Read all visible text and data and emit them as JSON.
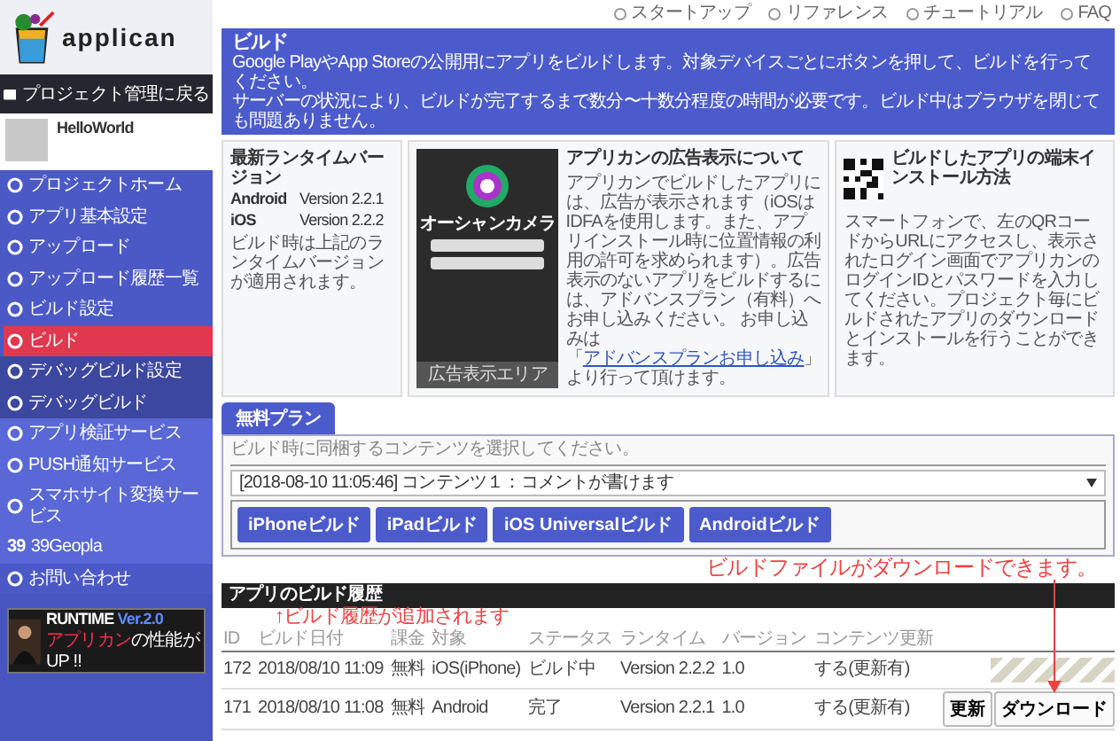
{
  "topbar": {
    "links": [
      {
        "label": "スタートアップ"
      },
      {
        "label": "リファレンス"
      },
      {
        "label": "チュートリアル"
      },
      {
        "label": "FAQ"
      }
    ]
  },
  "sidebar": {
    "logo": "applican",
    "back": "プロジェクト管理に戻る",
    "project": "HelloWorld",
    "items": [
      {
        "label": "プロジェクトホーム",
        "kind": "main",
        "selected": false
      },
      {
        "label": "アプリ基本設定",
        "kind": "main",
        "selected": false
      },
      {
        "label": "アップロード",
        "kind": "main",
        "selected": false
      },
      {
        "label": "アップロード履歴一覧",
        "kind": "main",
        "selected": false
      },
      {
        "label": "ビルド設定",
        "kind": "main",
        "selected": false
      },
      {
        "label": "ビルド",
        "kind": "main",
        "selected": true
      },
      {
        "label": "デバッグビルド設定",
        "kind": "debug",
        "selected": false
      },
      {
        "label": "デバッグビルド",
        "kind": "debug",
        "selected": false
      },
      {
        "label": "アプリ検証サービス",
        "kind": "service",
        "selected": false
      },
      {
        "label": "PUSH通知サービス",
        "kind": "service",
        "selected": false
      },
      {
        "label": "スマホサイト変換サービス",
        "kind": "service",
        "selected": false
      },
      {
        "label": "39Geopla",
        "kind": "service",
        "badge": "39",
        "selected": false
      },
      {
        "label": "お問い合わせ",
        "kind": "contact",
        "selected": false
      }
    ],
    "banner": {
      "title": "RUNTIME",
      "version": "Ver.2.0",
      "highlight": "アプリカン",
      "tagline": "の性能が UP !!"
    }
  },
  "header": {
    "title": "ビルド",
    "lines": [
      "Google PlayやApp Storeの公開用にアプリをビルドします。対象デバイスごとにボタンを押して、ビルドを行ってください。",
      "サーバーの状況により、ビルドが完了するまで数分〜十数分程度の時間が必要です。ビルド中はブラウザを閉じても問題ありません。"
    ]
  },
  "runtime_card": {
    "title": "最新ランタイムバージョン",
    "rows": [
      {
        "platform": "Android",
        "version": "Version 2.2.1"
      },
      {
        "platform": "iOS",
        "version": "Version 2.2.2"
      }
    ],
    "note": "ビルド時は上記のランタイムバージョンが適用されます。"
  },
  "ads_card": {
    "title": "アプリカンの広告表示について",
    "phone": {
      "app_title": "オーシャンカメラ",
      "ad_area": "広告表示エリア"
    },
    "text": "アプリカンでビルドしたアプリには、広告が表示されます（iOSはIDFAを使用します。また、アプリインストール時に位置情報の利用の許可を求められます）。広告表示のないアプリをビルドするには、アドバンスプラン（有料）へお申し込みください。 お申し込みは「",
    "link": "アドバンスプランお申し込み",
    "text_after": "」より行って頂けます。"
  },
  "install_card": {
    "title": "ビルドしたアプリの端末インストール方法",
    "text": "スマートフォンで、左のQRコードからURLにアクセスし、表示されたログイン画面でアプリカンのログインIDとパスワードを入力してください。プロジェクト毎にビルドされたアプリのダウンロードとインストールを行うことができます。"
  },
  "plan": {
    "tabs": [
      {
        "label": "無料プラン",
        "selected": true
      }
    ],
    "hint": "ビルド時に同梱するコンテンツを選択してください。",
    "content": "[2018-08-10 11:05:46] コンテンツ１：コメントが書けます",
    "buttons": [
      "iPhoneビルド",
      "iPadビルド",
      "iOS Universalビルド",
      "Androidビルド"
    ]
  },
  "annotations": {
    "download": "ビルドファイルがダウンロードできます。",
    "history": "↑ビルド履歴が追加されます"
  },
  "history": {
    "title": "アプリのビルド履歴",
    "columns": [
      "ID",
      "ビルド日付",
      "課金",
      "対象",
      "ステータス",
      "ランタイム",
      "バージョン",
      "コンテンツ更新"
    ],
    "rows": [
      {
        "kind": "building",
        "cells": [
          "172",
          "2018/08/10 11:09",
          "無料",
          "iOS(iPhone)",
          "ビルド中",
          "Version 2.2.2",
          "1.0",
          "する(更新有)"
        ]
      },
      {
        "kind": "done",
        "cells": [
          "171",
          "2018/08/10 11:08",
          "無料",
          "Android",
          "完了",
          "Version 2.2.1",
          "1.0",
          "する(更新有)"
        ],
        "actions": [
          "更新",
          "ダウンロード"
        ]
      }
    ]
  }
}
